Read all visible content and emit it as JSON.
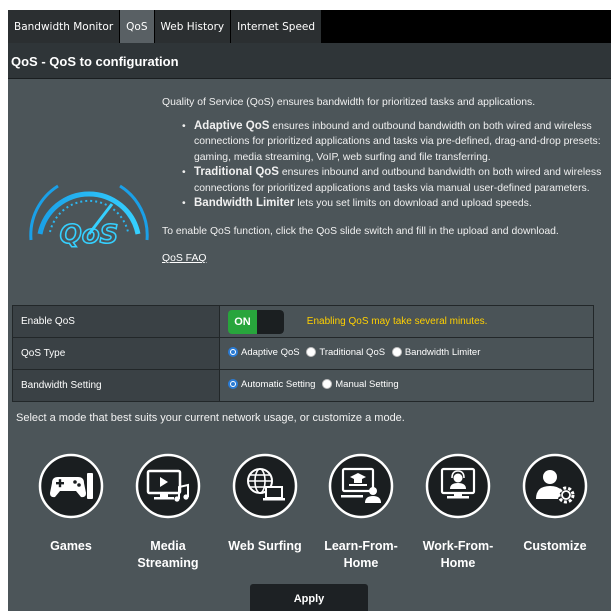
{
  "tabs": [
    {
      "label": "Bandwidth Monitor",
      "active": false
    },
    {
      "label": "QoS",
      "active": true
    },
    {
      "label": "Web History",
      "active": false
    },
    {
      "label": "Internet Speed",
      "active": false
    }
  ],
  "page_title": "QoS - QoS to configuration",
  "intro": {
    "lead": "Quality of Service (QoS) ensures bandwidth for prioritized tasks and applications.",
    "bullets": [
      {
        "strong": "Adaptive QoS",
        "text": " ensures inbound and outbound bandwidth on both wired and wireless connections for prioritized applications and tasks via pre-defined, drag-and-drop presets: gaming, media streaming, VoIP, web surfing and file transferring."
      },
      {
        "strong": "Traditional QoS",
        "text": " ensures inbound and outbound bandwidth on both wired and wireless connections for prioritized applications and tasks via manual user-defined parameters."
      },
      {
        "strong": "Bandwidth Limiter",
        "text": " lets you set limits on download and upload speeds."
      }
    ],
    "enable_text": "To enable QoS function, click the QoS slide switch and fill in the upload and download.",
    "faq_link": "QoS FAQ"
  },
  "logo_text": "QoS",
  "settings": {
    "enable_qos": {
      "label": "Enable QoS",
      "toggle_label": "ON",
      "warning": "Enabling QoS may take several minutes."
    },
    "qos_type": {
      "label": "QoS Type",
      "options": [
        "Adaptive QoS",
        "Traditional QoS",
        "Bandwidth Limiter"
      ],
      "selected": 0
    },
    "bandwidth_setting": {
      "label": "Bandwidth Setting",
      "options": [
        "Automatic Setting",
        "Manual Setting"
      ],
      "selected": 0
    }
  },
  "mode_hint": "Select a mode that best suits your current network usage, or customize a mode.",
  "modes": [
    {
      "line1": "Games",
      "line2": ""
    },
    {
      "line1": "Media",
      "line2": "Streaming"
    },
    {
      "line1": "Web Surfing",
      "line2": ""
    },
    {
      "line1": "Learn-From-",
      "line2": "Home"
    },
    {
      "line1": "Work-From-",
      "line2": "Home"
    },
    {
      "line1": "Customize",
      "line2": ""
    }
  ],
  "apply_label": "Apply",
  "colors": {
    "accent": "#2a7bd4",
    "toggle_on": "#28a53c",
    "warning": "#ffd000",
    "panel": "#4c5559"
  }
}
